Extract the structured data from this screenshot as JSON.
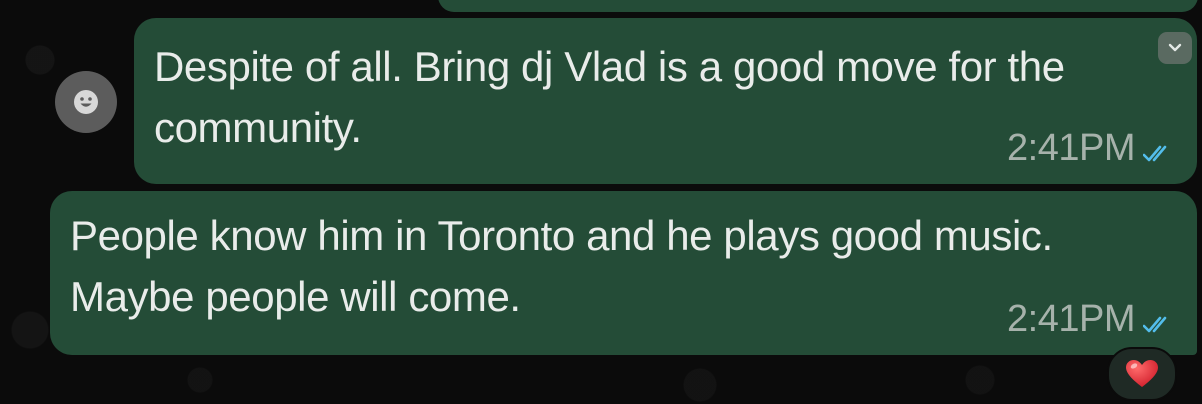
{
  "messages": [
    {
      "lines": [
        "Despite of all. Bring dj Vlad is a good move for the",
        "community."
      ],
      "time": "2:41PM",
      "status": "read"
    },
    {
      "lines": [
        "People know him in Toronto and he plays good music.",
        "Maybe people will come."
      ],
      "time": "2:41PM",
      "status": "read"
    }
  ],
  "reaction": {
    "emoji": "heart"
  },
  "colors": {
    "background": "#0b0b0b",
    "bubble_outgoing": "#244c37",
    "text": "#e9ecea",
    "timestamp": "#a6b2ab",
    "read_ticks": "#53bdeb",
    "heart": "#e0303a"
  },
  "icons": [
    "avatar-face-icon",
    "chevron-down-icon",
    "double-check-icon",
    "heart-icon"
  ]
}
